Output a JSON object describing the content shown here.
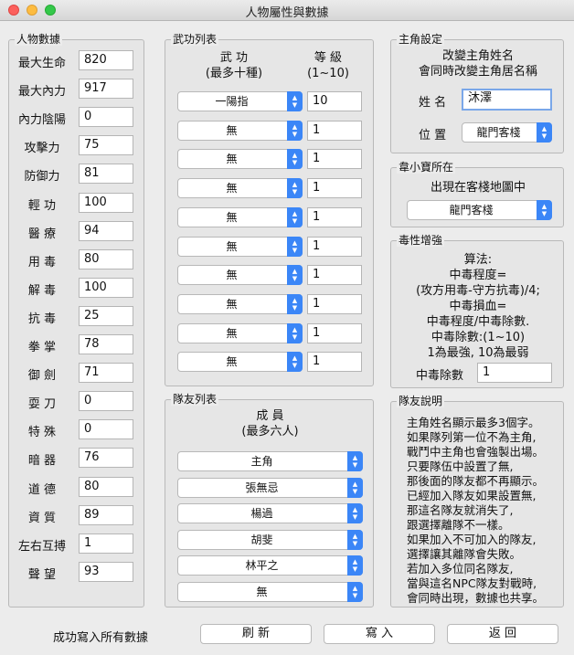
{
  "window": {
    "title": "人物屬性與數據"
  },
  "stats": {
    "title": "人物數據",
    "rows": [
      {
        "label": "最大生命",
        "value": "820"
      },
      {
        "label": "最大內力",
        "value": "917"
      },
      {
        "label": "內力陰陽",
        "value": "0"
      },
      {
        "label": "攻擊力",
        "value": "75"
      },
      {
        "label": "防御力",
        "value": "81"
      },
      {
        "label": "輕 功",
        "value": "100"
      },
      {
        "label": "醫 療",
        "value": "94"
      },
      {
        "label": "用 毒",
        "value": "80"
      },
      {
        "label": "解 毒",
        "value": "100"
      },
      {
        "label": "抗 毒",
        "value": "25"
      },
      {
        "label": "拳 掌",
        "value": "78"
      },
      {
        "label": "御 劍",
        "value": "71"
      },
      {
        "label": "耍 刀",
        "value": "0"
      },
      {
        "label": "特 殊",
        "value": "0"
      },
      {
        "label": "暗 器",
        "value": "76"
      },
      {
        "label": "道 德",
        "value": "80"
      },
      {
        "label": "資 質",
        "value": "89"
      },
      {
        "label": "左右互搏",
        "value": "1"
      },
      {
        "label": "聲 望",
        "value": "93"
      }
    ]
  },
  "martial": {
    "title": "武功列表",
    "col_skill": "武 功",
    "col_skill_sub": "(最多十種)",
    "col_level": "等 級",
    "col_level_sub": "(1~10)",
    "rows": [
      {
        "skill": "一陽指",
        "level": "10"
      },
      {
        "skill": "無",
        "level": "1"
      },
      {
        "skill": "無",
        "level": "1"
      },
      {
        "skill": "無",
        "level": "1"
      },
      {
        "skill": "無",
        "level": "1"
      },
      {
        "skill": "無",
        "level": "1"
      },
      {
        "skill": "無",
        "level": "1"
      },
      {
        "skill": "無",
        "level": "1"
      },
      {
        "skill": "無",
        "level": "1"
      },
      {
        "skill": "無",
        "level": "1"
      }
    ]
  },
  "team": {
    "title": "隊友列表",
    "header": "成 員",
    "header_sub": "(最多六人)",
    "members": [
      "主角",
      "張無忌",
      "楊過",
      "胡斐",
      "林平之",
      "無"
    ]
  },
  "protagonist": {
    "title": "主角設定",
    "note1": "改變主角姓名",
    "note2": "會同時改變主角居名稱",
    "name_label": "姓 名",
    "name_value": "沐澤",
    "pos_label": "位 置",
    "pos_value": "龍門客棧"
  },
  "wei": {
    "title": "韋小寶所在",
    "note": "出現在客棧地圖中",
    "location": "龍門客棧"
  },
  "poison": {
    "title": "毒性增強",
    "lines": [
      "算法:",
      "中毒程度=",
      "(攻方用毒-守方抗毒)/4;",
      "中毒損血=",
      "中毒程度/中毒除數.",
      "中毒除數:(1~10)",
      "1為最強, 10為最弱"
    ],
    "divisor_label": "中毒除數",
    "divisor_value": "1"
  },
  "team_note": {
    "title": "隊友說明",
    "lines": [
      "主角姓名顯示最多3個字。",
      "如果隊列第一位不為主角,",
      "戰鬥中主角也會強製出場。",
      "只要隊伍中設置了無,",
      "那後面的隊友都不再顯示。",
      "已經加入隊友如果設置無,",
      "那這名隊友就消失了,",
      "跟選擇離隊不一樣。",
      "如果加入不可加入的隊友,",
      "選擇讓其離隊會失敗。",
      "若加入多位同名隊友,",
      "當與這名NPC隊友對戰時,",
      "會同時出現，數據也共享。"
    ]
  },
  "footer": {
    "status": "成功寫入所有數據",
    "refresh": "刷 新",
    "write": "寫 入",
    "back": "返 回"
  }
}
